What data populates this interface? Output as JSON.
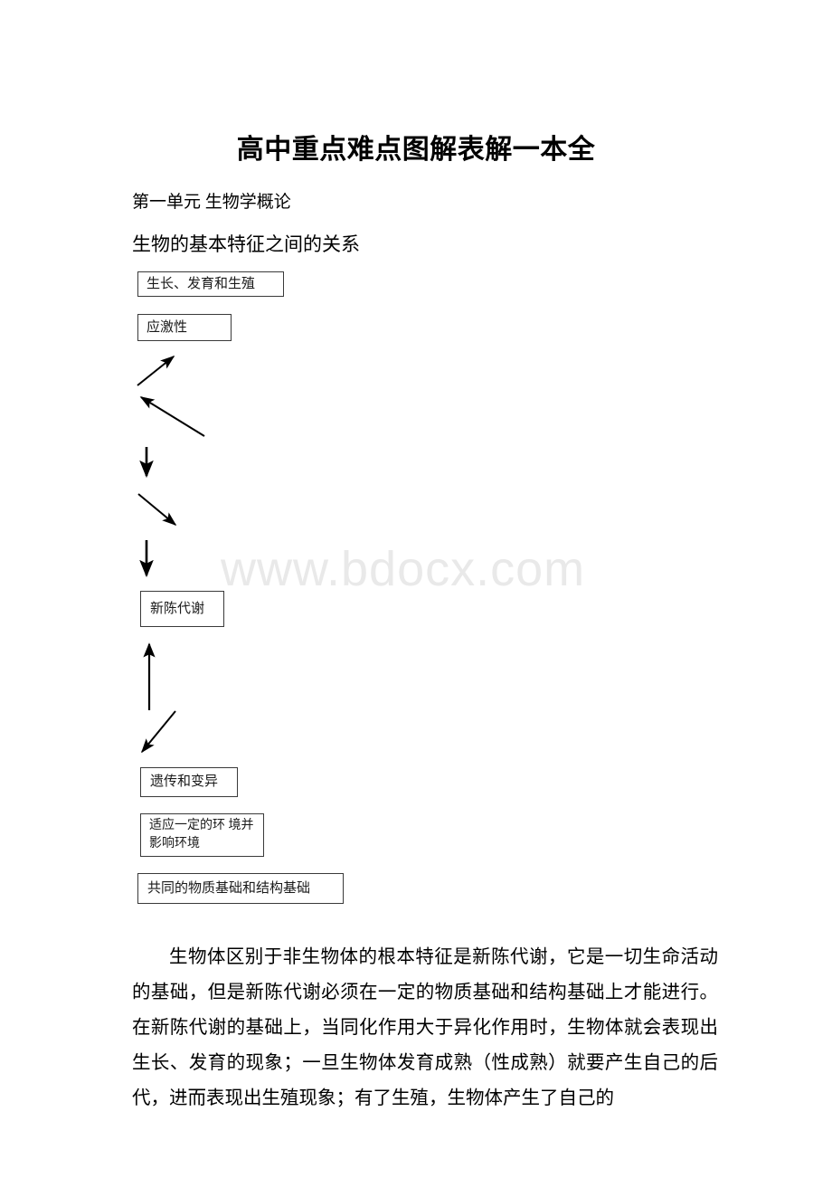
{
  "watermark": {
    "text": "www.bdocx.com",
    "color": "#e9e9e9"
  },
  "document": {
    "title": "高中重点难点图解表解一本全",
    "unit_heading": "第一单元 生物学概论",
    "section_heading": "生物的基本特征之间的关系",
    "body_paragraph": "生物体区别于非生物体的根本特征是新陈代谢，它是一切生命活动的基础，但是新陈代谢必须在一定的物质基础和结构基础上才能进行。在新陈代谢的基础上，当同化作用大于异化作用时，生物体就会表现出生长、发育的现象；一旦生物体发育成熟（性成熟）就要产生自己的后代，进而表现出生殖现象；有了生殖，生物体产生了自己的"
  },
  "diagram": {
    "nodes": [
      {
        "id": "growth",
        "label": "生长、发育和生殖"
      },
      {
        "id": "irritability",
        "label": "应激性"
      },
      {
        "id": "metabolism",
        "label": "新陈代谢"
      },
      {
        "id": "heredity",
        "label": "遗传和变异"
      },
      {
        "id": "adaptation",
        "line1": "适应一定的环",
        "line2": "境并影响环境"
      },
      {
        "id": "basis",
        "label": "共同的物质基础和结构基础"
      }
    ],
    "connector_color": "#000000"
  }
}
